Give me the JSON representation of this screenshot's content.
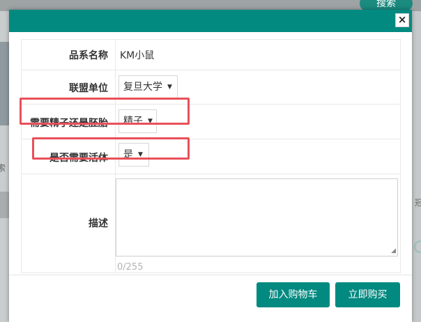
{
  "background": {
    "search_button_label": "搜索",
    "left_text": "索",
    "right_text": "冠"
  },
  "modal": {
    "close_label": "×",
    "fields": {
      "strain_name": {
        "label": "品系名称",
        "value": "KM小鼠"
      },
      "alliance_unit": {
        "label": "联盟单位",
        "selected": "复旦大学"
      },
      "sperm_or_embryo": {
        "label": "需要精子还是胚胎",
        "selected": "精子"
      },
      "need_live": {
        "label": "是否需要活体",
        "selected": "是"
      },
      "description": {
        "label": "描述",
        "value": "",
        "counter": "0/255"
      }
    },
    "buttons": {
      "add_to_cart": "加入购物车",
      "buy_now": "立即购买"
    }
  },
  "colors": {
    "accent": "#028a81",
    "highlight": "#e9505a"
  }
}
